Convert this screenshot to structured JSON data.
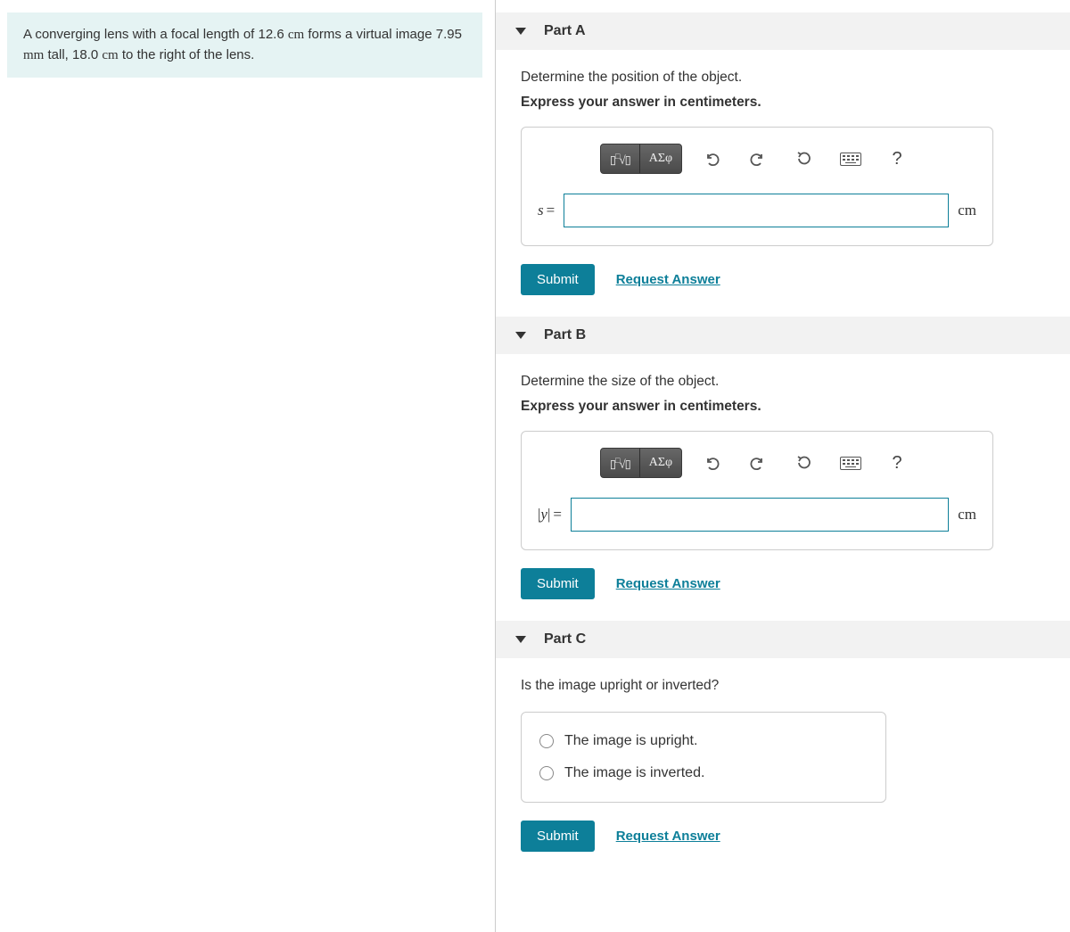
{
  "problem": {
    "text_before": "A converging lens with a focal length of 12.6 ",
    "unit1": "cm",
    "text_mid1": " forms a virtual image 7.95 ",
    "unit2": "mm",
    "text_mid2": " tall, 18.0 ",
    "unit3": "cm",
    "text_after": " to the right of the lens."
  },
  "toolbar": {
    "greek_label": "ΑΣφ",
    "help_label": "?"
  },
  "common": {
    "submit": "Submit",
    "request": "Request Answer"
  },
  "partA": {
    "title": "Part A",
    "prompt": "Determine the position of the object.",
    "instruction": "Express your answer in centimeters.",
    "var": "s",
    "eq": "=",
    "unit": "cm",
    "value": ""
  },
  "partB": {
    "title": "Part B",
    "prompt": "Determine the size of the object.",
    "instruction": "Express your answer in centimeters.",
    "var": "|y|",
    "eq": "=",
    "unit": "cm",
    "value": ""
  },
  "partC": {
    "title": "Part C",
    "prompt": "Is the image upright or inverted?",
    "options": [
      "The image is upright.",
      "The image is inverted."
    ]
  }
}
